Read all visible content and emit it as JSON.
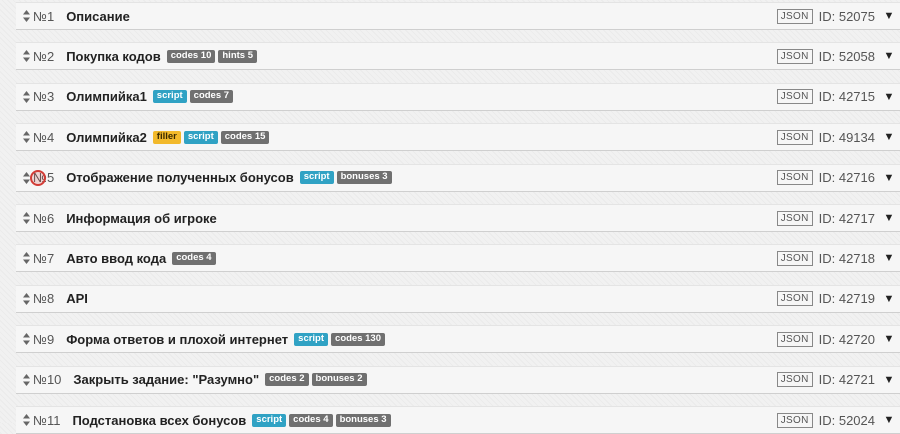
{
  "labels": {
    "json_button": "JSON",
    "id_prefix": "ID: ",
    "toggle_glyph": "▼"
  },
  "levels": [
    {
      "num": "№1",
      "title": "Описание",
      "badges": [],
      "id": "52075"
    },
    {
      "num": "№2",
      "title": "Покупка кодов",
      "badges": [
        {
          "text": "codes 10",
          "kind": "gray"
        },
        {
          "text": "hints 5",
          "kind": "gray"
        }
      ],
      "id": "52058"
    },
    {
      "num": "№3",
      "title": "Олимпийка1",
      "badges": [
        {
          "text": "script",
          "kind": "script"
        },
        {
          "text": "codes 7",
          "kind": "gray"
        }
      ],
      "id": "42715"
    },
    {
      "num": "№4",
      "title": "Олимпийка2",
      "badges": [
        {
          "text": "filler",
          "kind": "filler"
        },
        {
          "text": "script",
          "kind": "script"
        },
        {
          "text": "codes 15",
          "kind": "gray"
        }
      ],
      "id": "49134"
    },
    {
      "num": "№5",
      "title": "Отображение полученных бонусов",
      "badges": [
        {
          "text": "script",
          "kind": "script"
        },
        {
          "text": "bonuses 3",
          "kind": "gray"
        }
      ],
      "id": "42716"
    },
    {
      "num": "№6",
      "title": "Информация об игроке",
      "badges": [],
      "id": "42717"
    },
    {
      "num": "№7",
      "title": "Авто ввод кода",
      "badges": [
        {
          "text": "codes 4",
          "kind": "gray"
        }
      ],
      "id": "42718"
    },
    {
      "num": "№8",
      "title": "API",
      "badges": [],
      "id": "42719"
    },
    {
      "num": "№9",
      "title": "Форма ответов и плохой интернет",
      "badges": [
        {
          "text": "script",
          "kind": "script"
        },
        {
          "text": "codes 130",
          "kind": "gray"
        }
      ],
      "id": "42720"
    },
    {
      "num": "№10",
      "title": "Закрыть задание: \"Разумно\"",
      "badges": [
        {
          "text": "codes 2",
          "kind": "gray"
        },
        {
          "text": "bonuses 2",
          "kind": "gray"
        }
      ],
      "id": "42721"
    },
    {
      "num": "№11",
      "title": "Подстановка всех бонусов",
      "badges": [
        {
          "text": "script",
          "kind": "script"
        },
        {
          "text": "codes 4",
          "kind": "gray"
        },
        {
          "text": "bonuses 3",
          "kind": "gray"
        }
      ],
      "id": "52024"
    }
  ]
}
